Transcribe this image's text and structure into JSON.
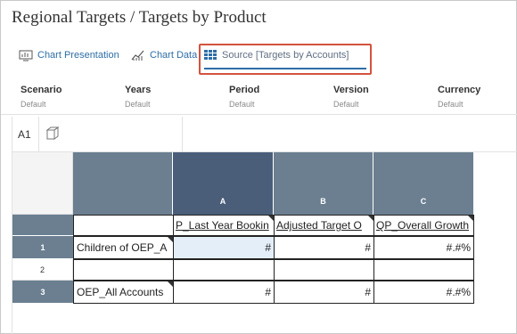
{
  "page": {
    "title": "Regional Targets / Targets by Product"
  },
  "tabs": [
    {
      "label": "Chart Presentation",
      "icon": "chart-presentation-icon"
    },
    {
      "label": "Chart Data",
      "icon": "chart-data-icon"
    },
    {
      "label": "Source [Targets by Accounts]",
      "icon": "grid-icon",
      "selected": true
    }
  ],
  "pov": [
    {
      "label": "Scenario",
      "value": "Default"
    },
    {
      "label": "Years",
      "value": "Default"
    },
    {
      "label": "Period",
      "value": "Default"
    },
    {
      "label": "Version",
      "value": "Default"
    },
    {
      "label": "Currency",
      "value": "Default"
    }
  ],
  "formula_bar": {
    "cell_ref": "A1"
  },
  "grid": {
    "columns": [
      "A",
      "B",
      "C"
    ],
    "column_headers": [
      "OEP_Last Year Bookings",
      "Adjusted Target OEP_Overall Growth",
      "OEP_Overall Growth"
    ],
    "header_texts": [
      "P_Last Year Bookin",
      "Adjusted Target O",
      "QP_Overall Growth"
    ],
    "rows": [
      {
        "num": "1",
        "label": "Children of OEP_A",
        "values": [
          "#",
          "#",
          "#.#%"
        ]
      },
      {
        "num": "2",
        "label": "",
        "values": [
          "",
          "",
          ""
        ]
      },
      {
        "num": "3",
        "label": "OEP_All Accounts",
        "values": [
          "#",
          "#",
          "#.#%"
        ]
      }
    ]
  },
  "colors": {
    "accent": "#2e6ea6",
    "header": "#6b7f91",
    "header_selected": "#4a5e7a",
    "highlight": "#d3533e"
  }
}
